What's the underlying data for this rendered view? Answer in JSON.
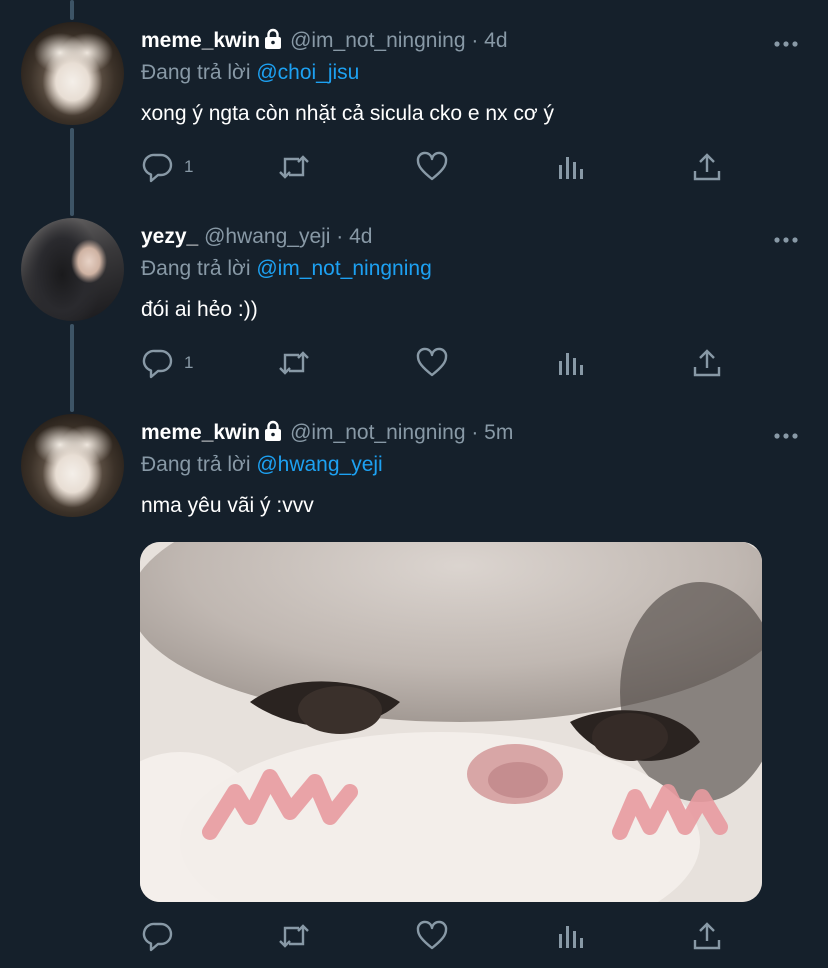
{
  "tweets": [
    {
      "name": "meme_kwin",
      "handle": "@im_not_ningning · 4d",
      "reply_label": "Đang trả lời",
      "reply_mention": "@choi_jisu",
      "text": "xong ý ngta còn nhặt cả sicula cko e nx cơ ý",
      "reply_count": "1"
    },
    {
      "name": "yezy_",
      "handle": "@hwang_yeji · 4d",
      "reply_label": "Đang trả lời",
      "reply_mention": "@im_not_ningning",
      "text": "đói ai hẻo :))",
      "reply_count": "1"
    },
    {
      "name": "meme_kwin",
      "handle": "@im_not_ningning · 5m",
      "reply_label": "Đang trả lời",
      "reply_mention": "@hwang_yeji",
      "text": "nma yêu vãi ý :vvv",
      "reply_count": ""
    }
  ],
  "colors": {
    "background": "#15202b",
    "text": "#ffffff",
    "secondary": "#8899a6",
    "link": "#1da1f2",
    "thread_line": "#3d5466"
  },
  "icons": [
    "lock-icon",
    "more-icon",
    "reply-icon",
    "retweet-icon",
    "like-icon",
    "analytics-icon",
    "share-icon"
  ]
}
